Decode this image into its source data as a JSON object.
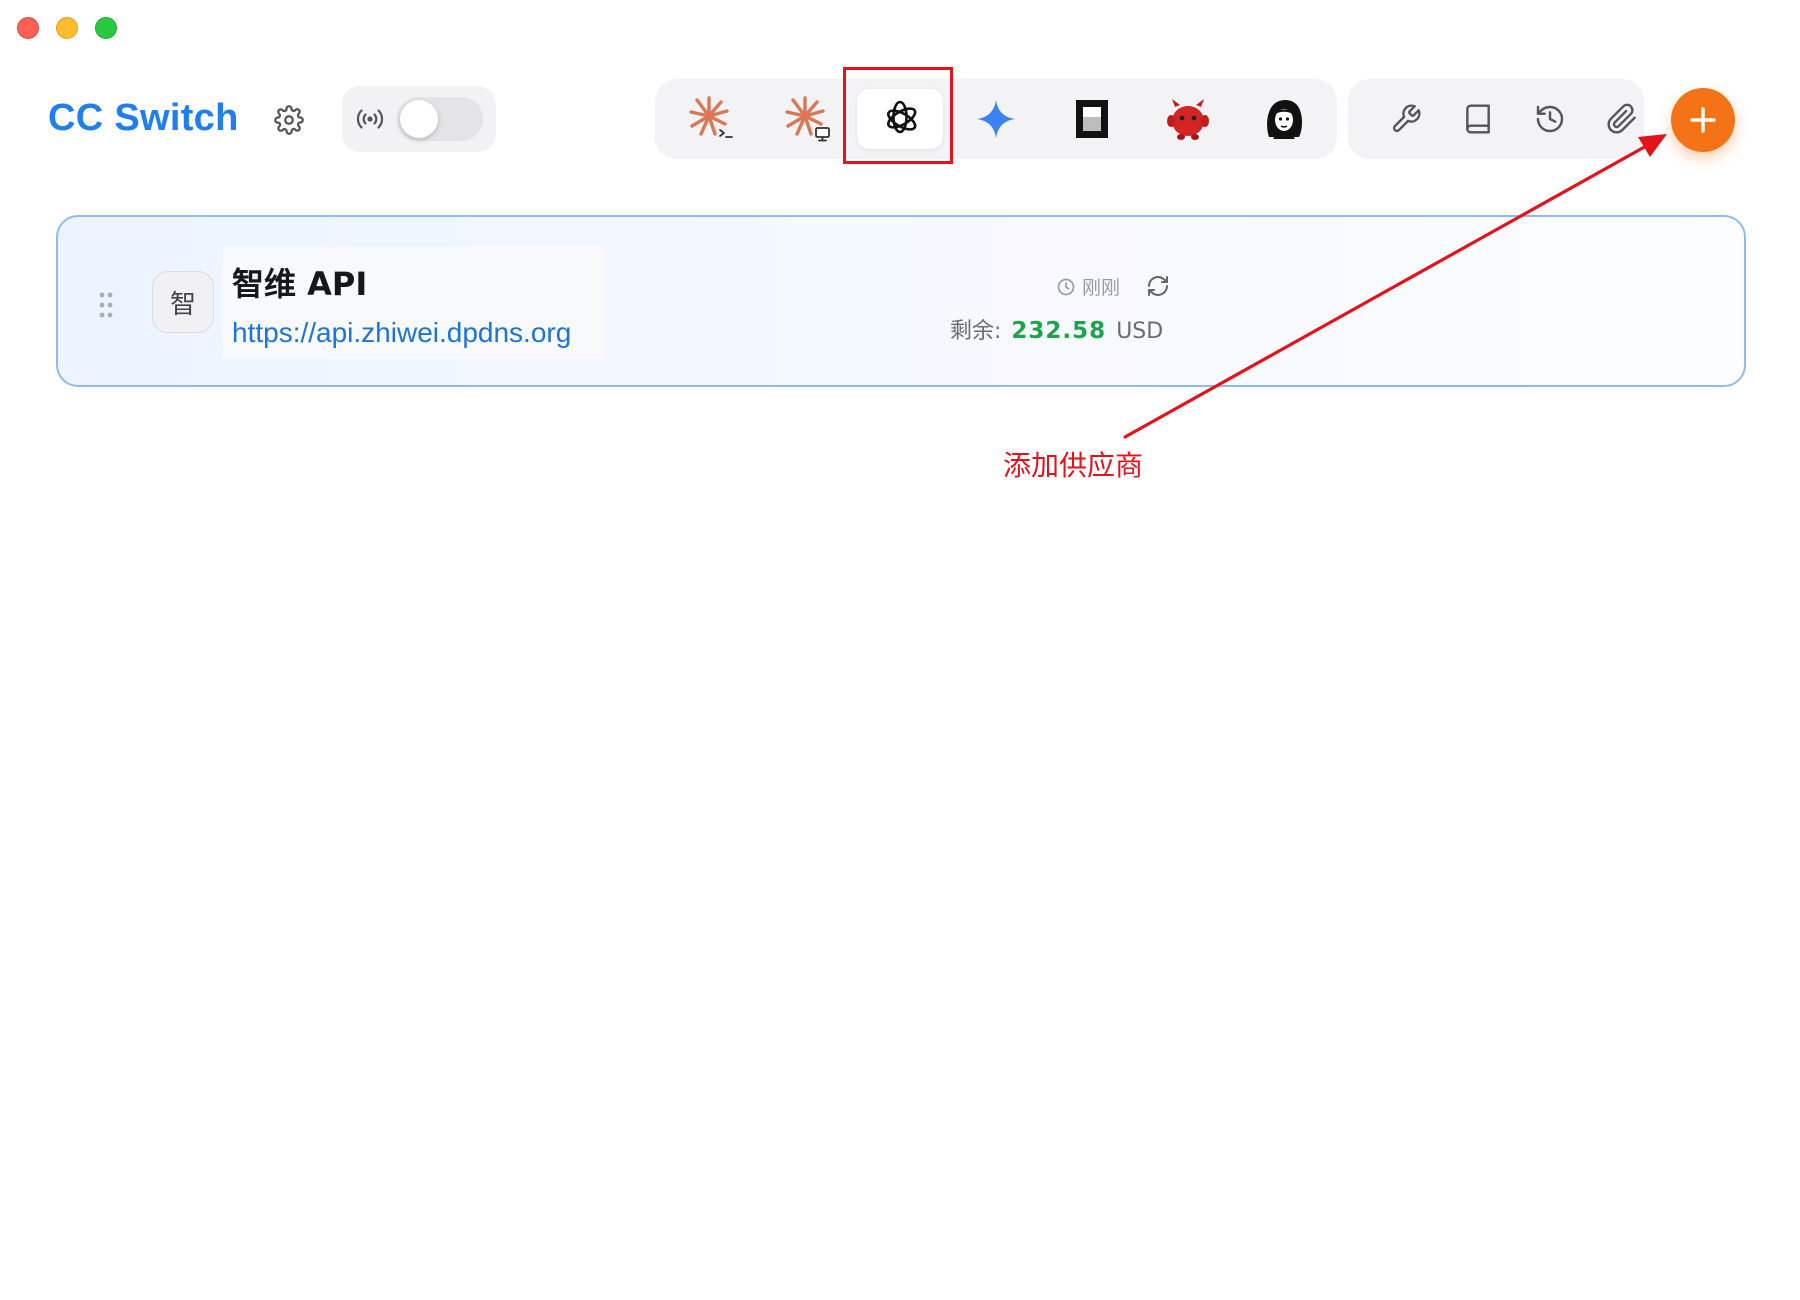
{
  "window": {
    "controls": [
      "close",
      "minimize",
      "zoom"
    ]
  },
  "header": {
    "app_title": "CC Switch",
    "settings_icon": "gear-icon",
    "proxy_icon": "radio-signal-icon",
    "proxy_enabled": false
  },
  "app_tabs": [
    {
      "name": "claude-code",
      "icon": "claude-cli-icon",
      "active": false
    },
    {
      "name": "claude-desktop",
      "icon": "claude-desktop-icon",
      "active": false
    },
    {
      "name": "codex",
      "icon": "openai-icon",
      "active": true
    },
    {
      "name": "gemini",
      "icon": "gemini-sparkle-icon",
      "active": false
    },
    {
      "name": "opencode",
      "icon": "opencode-icon",
      "active": false
    },
    {
      "name": "red-mascot",
      "icon": "red-mascot-icon",
      "active": false
    },
    {
      "name": "portrait",
      "icon": "portrait-icon",
      "active": false
    }
  ],
  "tools": [
    {
      "name": "wrench",
      "icon": "wrench-icon"
    },
    {
      "name": "book",
      "icon": "book-icon"
    },
    {
      "name": "history",
      "icon": "history-icon"
    },
    {
      "name": "attachment",
      "icon": "paperclip-icon"
    }
  ],
  "add_button": {
    "icon": "plus-icon"
  },
  "provider": {
    "avatar_char": "智",
    "name": "智维 API",
    "url": "https://api.zhiwei.dpdns.org",
    "updated": "刚刚",
    "balance_label": "剩余:",
    "balance_value": "232.58",
    "balance_unit": "USD"
  },
  "annotation": {
    "text": "添加供应商",
    "color": "#e3121b"
  },
  "colors": {
    "accent_blue": "#1f7ff0",
    "add_orange": "#f57317",
    "balance_green": "#1fa34a"
  }
}
